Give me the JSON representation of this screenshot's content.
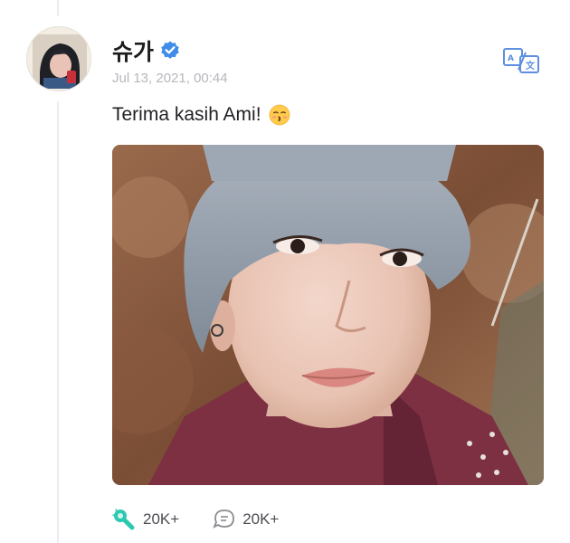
{
  "post": {
    "author_name": "슈가",
    "timestamp": "Jul 13, 2021, 00:44",
    "text": "Terima kasih Ami!",
    "emoji": "kissing-face-emoji"
  },
  "icons": {
    "verified": "verified-badge-icon",
    "translate": "translate-icon",
    "like": "lightstick-like-icon",
    "comment": "comment-bubble-icon"
  },
  "actions": {
    "likes": "20K+",
    "comments": "20K+"
  },
  "colors": {
    "verified_blue": "#3f8de8",
    "translate_blue": "#5e8fe0",
    "like_teal": "#2cc9b0",
    "text_dark": "#1d1d1f",
    "timestamp_gray": "#b7b7bd"
  }
}
